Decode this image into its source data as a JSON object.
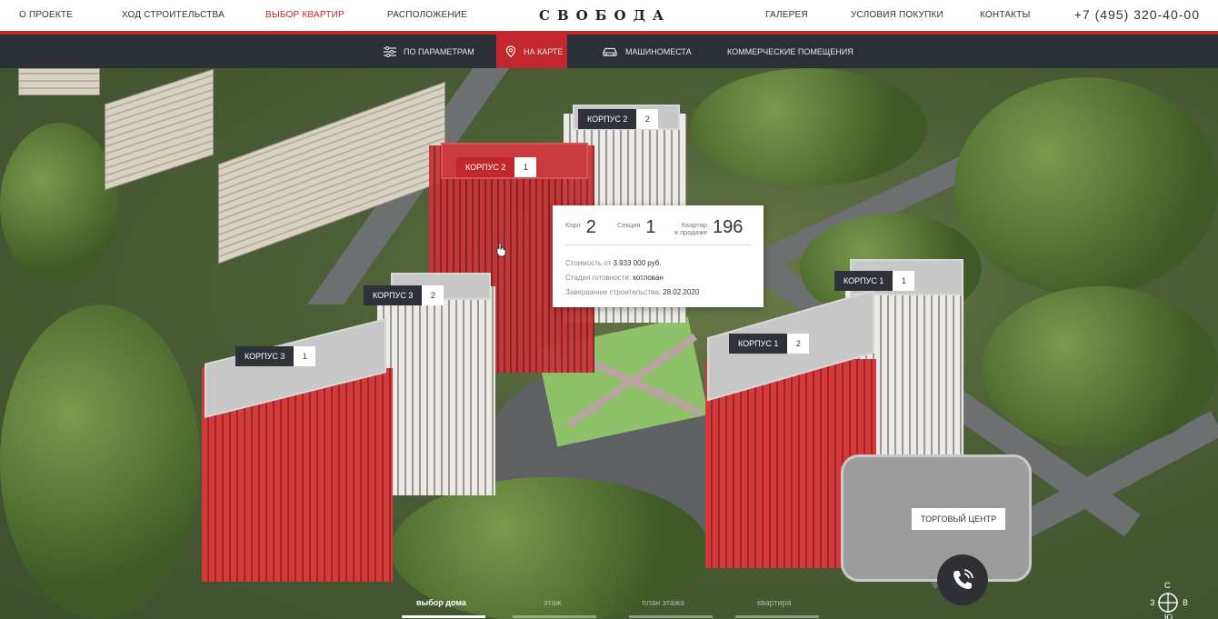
{
  "header": {
    "nav_left": [
      "О ПРОЕКТЕ",
      "ХОД СТРОИТЕЛЬСТВА",
      "ВЫБОР КВАРТИР",
      "РАСПОЛОЖЕНИЕ"
    ],
    "logo": "СВОБОДА",
    "nav_right": [
      "ГАЛЕРЕЯ",
      "УСЛОВИЯ ПОКУПКИ",
      "КОНТАКТЫ"
    ],
    "phone": "+7 (495) 320-40-00",
    "accent_color": "#c2272d"
  },
  "subnav": {
    "tabs": [
      {
        "label": "ПО ПАРАМЕТРАМ",
        "icon": "sliders-icon"
      },
      {
        "label": "НА КАРТЕ",
        "icon": "map-pin-icon",
        "active": true
      },
      {
        "label": "МАШИНОМЕСТА",
        "icon": "car-icon"
      },
      {
        "label": "КОММЕРЧЕСКИЕ ПОМЕЩЕНИЯ",
        "icon": ""
      }
    ]
  },
  "map": {
    "labels": [
      {
        "name": "КОРПУС 2",
        "num": "2"
      },
      {
        "name": "КОРПУС 2",
        "num": "1",
        "active": true
      },
      {
        "name": "КОРПУС 3",
        "num": "2"
      },
      {
        "name": "КОРПУС 3",
        "num": "1"
      },
      {
        "name": "КОРПУС 1",
        "num": "1"
      },
      {
        "name": "КОРПУС 1",
        "num": "2"
      }
    ],
    "mall_label": "ТОРГОВЫЙ ЦЕНТР"
  },
  "popup": {
    "korp_label": "Корп",
    "korp_value": "2",
    "section_label": "Секция",
    "section_value": "1",
    "flats_label_1": "Квартир",
    "flats_label_2": "в продаже",
    "flats_value": "196",
    "price_label": "Стоимость от",
    "price_value": "3.933 000 руб.",
    "stage_label": "Стадия готовности:",
    "stage_value": "котлован",
    "finish_label": "Завершение строительства:",
    "finish_value": "28.02.2020"
  },
  "steps": [
    "выбор дома",
    "этаж",
    "план этажа",
    "квартира"
  ],
  "compass": {
    "n": "С",
    "w": "З",
    "e": "В",
    "s": "Ю"
  }
}
